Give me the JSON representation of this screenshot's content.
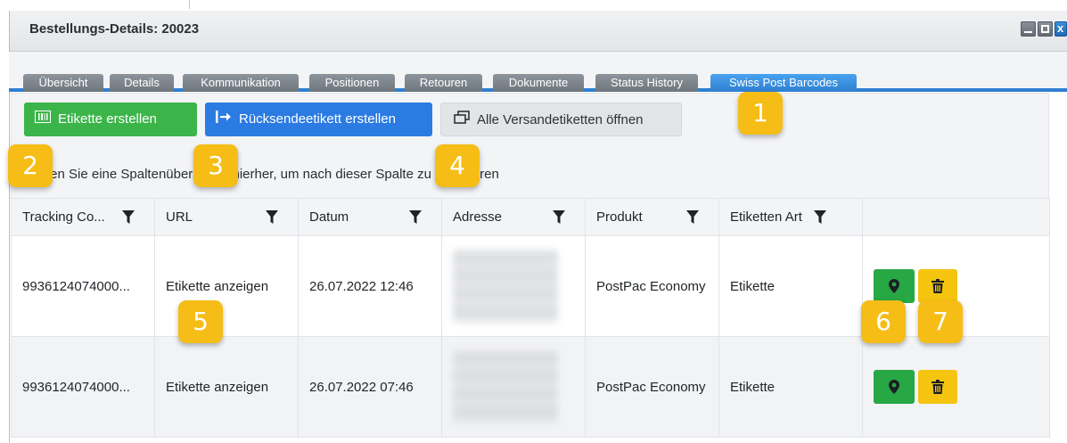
{
  "window": {
    "title": "Bestellungs-Details: 20023",
    "controls": [
      "minimize-icon",
      "maximize-icon",
      "close-icon"
    ],
    "close_glyph": "x"
  },
  "tabs": [
    {
      "label": "Übersicht",
      "active": false
    },
    {
      "label": "Details",
      "active": false
    },
    {
      "label": "Kommunikation",
      "active": false
    },
    {
      "label": "Positionen",
      "active": false
    },
    {
      "label": "Retouren",
      "active": false
    },
    {
      "label": "Dokumente",
      "active": false
    },
    {
      "label": "Status History",
      "active": false
    },
    {
      "label": "Swiss Post Barcodes",
      "active": true
    }
  ],
  "toolbar": {
    "create_label": "Etikette erstellen",
    "return_label": "Rücksendeetikett erstellen",
    "open_all_label": "Alle Versandetiketten öffnen"
  },
  "groupbar": {
    "text": "Ziehen Sie eine Spaltenüberschrift hierher, um nach dieser Spalte zu gruppieren"
  },
  "grid": {
    "columns": [
      "Tracking Co...",
      "URL",
      "Datum",
      "Adresse",
      "Produkt",
      "Etiketten Art",
      ""
    ],
    "rows": [
      {
        "tracking": "9936124074000...",
        "url": "Etikette anzeigen",
        "datum": "26.07.2022 12:46",
        "produkt": "PostPac Economy",
        "art": "Etikette"
      },
      {
        "tracking": "9936124074000...",
        "url": "Etikette anzeigen",
        "datum": "26.07.2022 07:46",
        "produkt": "PostPac Economy",
        "art": "Etikette"
      }
    ]
  },
  "callouts": [
    "1",
    "2",
    "3",
    "4",
    "5",
    "6",
    "7"
  ],
  "colors": {
    "accent": "#2f7fd1",
    "green": "#3bb54a",
    "blue_button": "#2b7be3",
    "yellow_button": "#f5c40f",
    "callout": "#f5bd16"
  }
}
